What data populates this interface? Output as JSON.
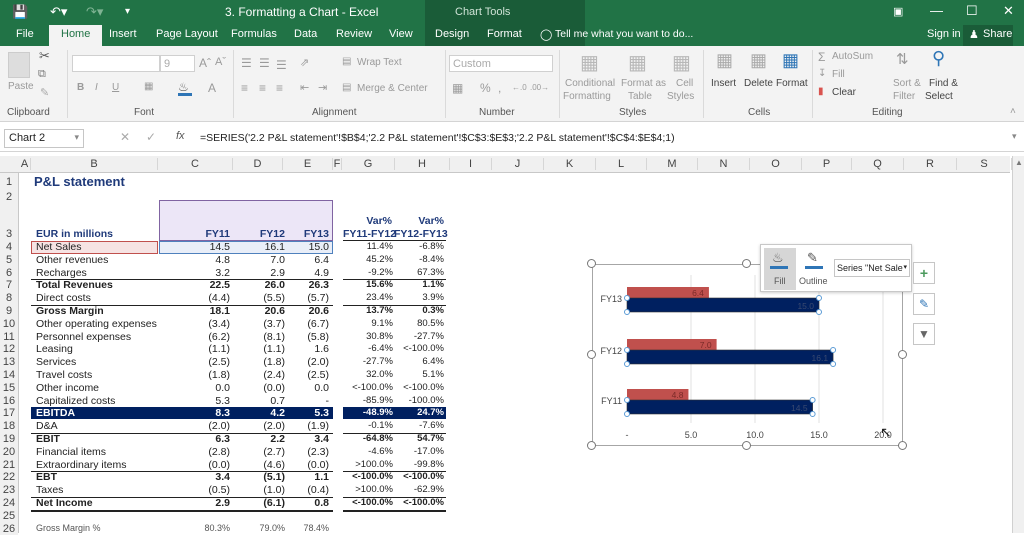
{
  "window": {
    "title": "3. Formatting a Chart - Excel",
    "context_label": "Chart Tools",
    "icons": [
      "save-icon",
      "undo-icon",
      "redo-icon",
      "customize-qat-icon"
    ],
    "controls": [
      "ribbon-display-icon",
      "minimize-icon",
      "maximize-icon",
      "close-icon"
    ]
  },
  "tabs": [
    {
      "label": "File"
    },
    {
      "label": "Home",
      "active": true
    },
    {
      "label": "Insert"
    },
    {
      "label": "Page Layout"
    },
    {
      "label": "Formulas"
    },
    {
      "label": "Data"
    },
    {
      "label": "Review"
    },
    {
      "label": "View"
    },
    {
      "label": "Design"
    },
    {
      "label": "Format"
    }
  ],
  "tellme": "Tell me what you want to do...",
  "signin": "Sign in",
  "share": "Share",
  "ribbon": {
    "clipboard": {
      "paste": "Paste",
      "label": "Clipboard"
    },
    "font": {
      "size": "9",
      "label": "Font",
      "bold": "B",
      "italic": "I",
      "underline": "U"
    },
    "alignment": {
      "wrap": "Wrap Text",
      "merge": "Merge & Center",
      "label": "Alignment"
    },
    "number": {
      "format": "Custom",
      "percent": "%",
      "comma": ",",
      "label": "Number"
    },
    "styles": {
      "conditional": "Conditional",
      "conditional2": "Formatting",
      "table": "Format as",
      "table2": "Table",
      "cell": "Cell",
      "cell2": "Styles",
      "label": "Styles"
    },
    "cells": {
      "insert": "Insert",
      "delete": "Delete",
      "format": "Format",
      "label": "Cells"
    },
    "editing": {
      "autosum": "AutoSum",
      "fill": "Fill",
      "clear": "Clear",
      "sort": "Sort &",
      "sort2": "Filter",
      "find": "Find &",
      "find2": "Select",
      "label": "Editing"
    }
  },
  "formula_bar": {
    "name_box": "Chart 2",
    "formula": "=SERIES('2.2 P&L statement'!$B$4;'2.2 P&L statement'!$C$3:$E$3;'2.2 P&L statement'!$C$4:$E$4;1)"
  },
  "columns": [
    "A",
    "B",
    "C",
    "D",
    "E",
    "F",
    "G",
    "H",
    "I",
    "J",
    "K",
    "L",
    "M",
    "N",
    "O",
    "P",
    "Q",
    "R",
    "S"
  ],
  "sheet": {
    "title": "P&L statement",
    "header_label": "EUR in millions",
    "years": [
      "FY11",
      "FY12",
      "FY13"
    ],
    "var_headers": [
      [
        "Var%",
        "FY11-FY12"
      ],
      [
        "Var%",
        "FY12-FY13"
      ]
    ],
    "rows": [
      {
        "n": "4",
        "label": "Net Sales",
        "v": [
          "14.5",
          "16.1",
          "15.0"
        ],
        "p": [
          "11.4%",
          "-6.8%"
        ]
      },
      {
        "n": "5",
        "label": "Other revenues",
        "v": [
          "4.8",
          "7.0",
          "6.4"
        ],
        "p": [
          "45.2%",
          "-8.4%"
        ]
      },
      {
        "n": "6",
        "label": "Recharges",
        "v": [
          "3.2",
          "2.9",
          "4.9"
        ],
        "p": [
          "-9.2%",
          "67.3%"
        ]
      },
      {
        "n": "7",
        "label": "Total Revenues",
        "v": [
          "22.5",
          "26.0",
          "26.3"
        ],
        "p": [
          "15.6%",
          "1.1%"
        ],
        "bold": true
      },
      {
        "n": "8",
        "label": "Direct costs",
        "v": [
          "(4.4)",
          "(5.5)",
          "(5.7)"
        ],
        "p": [
          "23.4%",
          "3.9%"
        ]
      },
      {
        "n": "9",
        "label": "Gross Margin",
        "v": [
          "18.1",
          "20.6",
          "20.6"
        ],
        "p": [
          "13.7%",
          "0.3%"
        ],
        "bold": true
      },
      {
        "n": "10",
        "label": "Other operating expenses",
        "v": [
          "(3.4)",
          "(3.7)",
          "(6.7)"
        ],
        "p": [
          "9.1%",
          "80.5%"
        ]
      },
      {
        "n": "11",
        "label": "Personnel expenses",
        "v": [
          "(6.2)",
          "(8.1)",
          "(5.8)"
        ],
        "p": [
          "30.8%",
          "-27.7%"
        ]
      },
      {
        "n": "12",
        "label": "Leasing",
        "v": [
          "(1.1)",
          "(1.1)",
          "1.6"
        ],
        "p": [
          "-6.4%",
          "<-100.0%"
        ]
      },
      {
        "n": "13",
        "label": "Services",
        "v": [
          "(2.5)",
          "(1.8)",
          "(2.0)"
        ],
        "p": [
          "-27.7%",
          "6.4%"
        ]
      },
      {
        "n": "14",
        "label": "Travel costs",
        "v": [
          "(1.8)",
          "(2.4)",
          "(2.5)"
        ],
        "p": [
          "32.0%",
          "5.1%"
        ]
      },
      {
        "n": "15",
        "label": "Other income",
        "v": [
          "0.0",
          "(0.0)",
          "0.0"
        ],
        "p": [
          "<-100.0%",
          "<-100.0%"
        ]
      },
      {
        "n": "16",
        "label": "Capitalized costs",
        "v": [
          "5.3",
          "0.7",
          "-"
        ],
        "p": [
          "-85.9%",
          "-100.0%"
        ]
      },
      {
        "n": "17",
        "label": "EBITDA",
        "v": [
          "8.3",
          "4.2",
          "5.3"
        ],
        "p": [
          "-48.9%",
          "24.7%"
        ],
        "highlight": true
      },
      {
        "n": "18",
        "label": "D&A",
        "v": [
          "(2.0)",
          "(2.0)",
          "(1.9)"
        ],
        "p": [
          "-0.1%",
          "-7.6%"
        ]
      },
      {
        "n": "19",
        "label": "EBIT",
        "v": [
          "6.3",
          "2.2",
          "3.4"
        ],
        "p": [
          "-64.8%",
          "54.7%"
        ],
        "bold": true
      },
      {
        "n": "20",
        "label": "Financial items",
        "v": [
          "(2.8)",
          "(2.7)",
          "(2.3)"
        ],
        "p": [
          "-4.6%",
          "-17.0%"
        ]
      },
      {
        "n": "21",
        "label": "Extraordinary items",
        "v": [
          "(0.0)",
          "(4.6)",
          "(0.0)"
        ],
        "p": [
          ">100.0%",
          "-99.8%"
        ]
      },
      {
        "n": "22",
        "label": "EBT",
        "v": [
          "3.4",
          "(5.1)",
          "1.1"
        ],
        "p": [
          "<-100.0%",
          "<-100.0%"
        ],
        "bold": true
      },
      {
        "n": "23",
        "label": "Taxes",
        "v": [
          "(0.5)",
          "(1.0)",
          "(0.4)"
        ],
        "p": [
          ">100.0%",
          "-62.9%"
        ]
      },
      {
        "n": "24",
        "label": "Net Income",
        "v": [
          "2.9",
          "(6.1)",
          "0.8"
        ],
        "p": [
          "<-100.0%",
          "<-100.0%"
        ],
        "bold": true
      },
      {
        "n": "25",
        "label": "",
        "v": [
          "",
          "",
          ""
        ],
        "p": [
          "",
          ""
        ]
      },
      {
        "n": "26",
        "label": "Gross Margin %",
        "v": [
          "80.3%",
          "79.0%",
          "78.4%"
        ],
        "p": [
          "",
          ""
        ],
        "small": true
      }
    ]
  },
  "chart_popup": {
    "fill": "Fill",
    "outline": "Outline",
    "series": "Series \"Net Sale"
  },
  "chart_side_buttons": [
    "chart-elements-plus-icon",
    "chart-styles-brush-icon",
    "chart-filters-funnel-icon"
  ],
  "chart_data": {
    "type": "bar",
    "orientation": "horizontal",
    "categories": [
      "FY11",
      "FY12",
      "FY13"
    ],
    "series": [
      {
        "name": "Other revenues",
        "color": "#c0504d",
        "values": [
          4.8,
          7.0,
          6.4
        ]
      },
      {
        "name": "Net Sales",
        "color": "#002060",
        "values": [
          14.5,
          16.1,
          15.0
        ]
      }
    ],
    "xticks": [
      "-",
      "5.0",
      "10.0",
      "15.0",
      "20.0"
    ],
    "xlim": [
      0,
      20
    ],
    "grid": true,
    "title": "",
    "xlabel": "",
    "ylabel": ""
  }
}
